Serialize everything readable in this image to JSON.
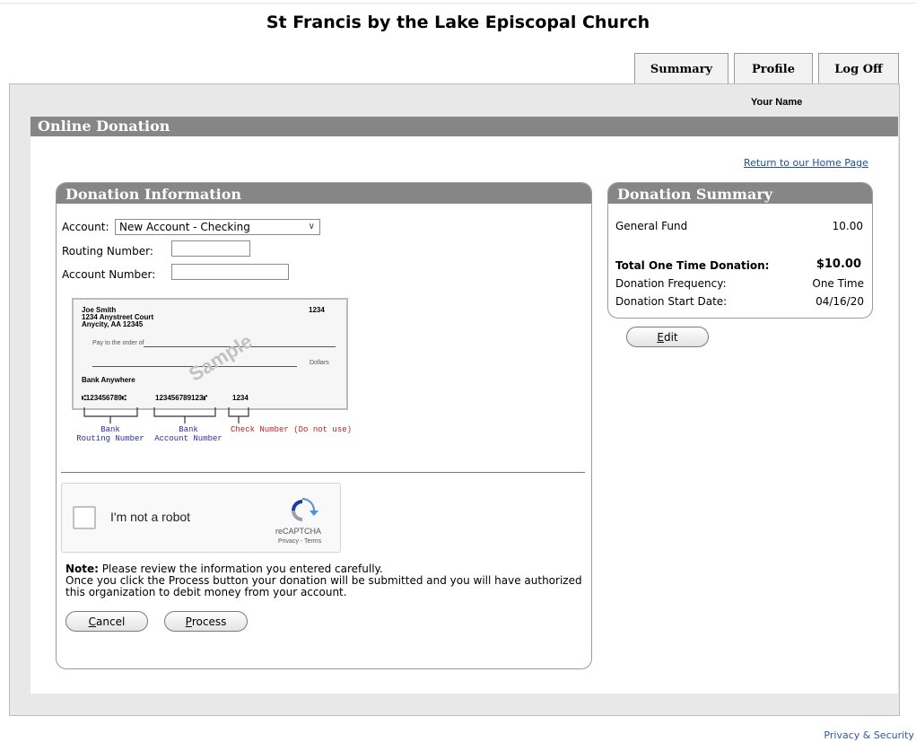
{
  "site": {
    "title": "St Francis by the Lake Episcopal Church"
  },
  "tabs": [
    {
      "label": "Summary"
    },
    {
      "label": "Profile"
    },
    {
      "label": "Log Off"
    }
  ],
  "user": {
    "name": "Your Name"
  },
  "page": {
    "title": "Online Donation",
    "home_link": "Return to our Home Page"
  },
  "donation_info": {
    "title": "Donation Information",
    "account_label": "Account:",
    "account_value": "New Account - Checking",
    "routing_label": "Routing Number:",
    "routing_value": "",
    "account_number_label": "Account Number:",
    "account_number_value": ""
  },
  "check_sample": {
    "name": "Joe Smith",
    "address1": "1234 Anystreet Court",
    "address2": "Anycity, AA 12345",
    "check_no": "1234",
    "pay_to": "Pay to the order of",
    "dollars": "Dollars",
    "bank": "Bank Anywhere",
    "micr_routing": "⑆123456789⑆",
    "micr_account": "123456789123⑈",
    "micr_check": "1234",
    "watermark": "Sample",
    "caption_routing": "Bank\nRouting Number",
    "caption_account": "Bank\nAccount Number",
    "caption_check": "Check Number (Do not use)"
  },
  "recaptcha": {
    "label": "I'm not a robot",
    "brand": "reCAPTCHA",
    "terms": "Privacy - Terms"
  },
  "note": {
    "bold": "Note:",
    "line1": " Please review the information you entered carefully.",
    "line2": "Once you click the Process button your donation will be submitted and you will have authorized this organization to debit money from your account."
  },
  "buttons": {
    "cancel_u": "C",
    "cancel_rest": "ancel",
    "process_u": "P",
    "process_rest": "rocess",
    "edit_u": "E",
    "edit_rest": "dit"
  },
  "summary": {
    "title": "Donation Summary",
    "fund_label": "General Fund",
    "fund_value": "10.00",
    "total_label": "Total One Time Donation:",
    "total_value": "$10.00",
    "frequency_label": "Donation Frequency:",
    "frequency_value": "One Time",
    "start_label": "Donation Start Date:",
    "start_value": "04/16/20"
  },
  "footer": {
    "privacy": "Privacy & Security"
  }
}
